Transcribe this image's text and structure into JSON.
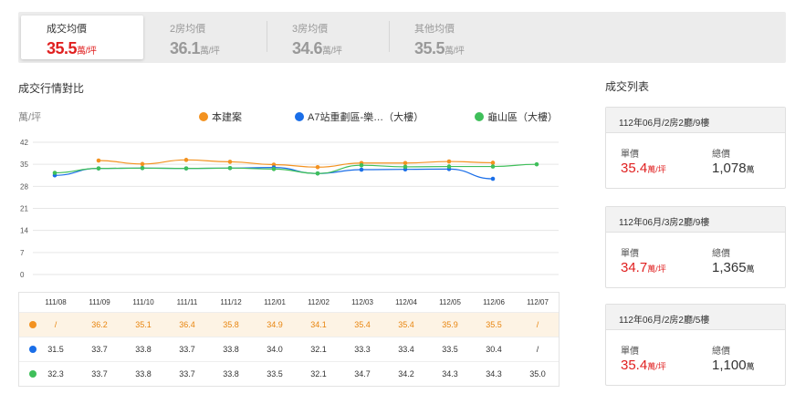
{
  "tabs": [
    {
      "label": "成交均價",
      "value": "35.5",
      "unit": "萬/坪"
    },
    {
      "label": "2房均價",
      "value": "36.1",
      "unit": "萬/坪"
    },
    {
      "label": "3房均價",
      "value": "34.6",
      "unit": "萬/坪"
    },
    {
      "label": "其他均價",
      "value": "35.5",
      "unit": "萬/坪"
    }
  ],
  "trend": {
    "title": "成交行情對比",
    "unit": "萬/坪",
    "legend": [
      "本建案",
      "A7站重劃區-樂…（大樓）",
      "龜山區（大樓）"
    ]
  },
  "chart_data": {
    "type": "line",
    "x": [
      "111/08",
      "111/09",
      "111/10",
      "111/11",
      "111/12",
      "112/01",
      "112/02",
      "112/03",
      "112/04",
      "112/05",
      "112/06",
      "112/07"
    ],
    "ylim": [
      0,
      42
    ],
    "yticks": [
      0,
      7,
      14,
      21,
      28,
      35,
      42
    ],
    "grid": true,
    "legend_position": "top",
    "series": [
      {
        "name": "本建案",
        "color": "#f39220",
        "values": [
          null,
          36.2,
          35.1,
          36.4,
          35.8,
          34.9,
          34.1,
          35.4,
          35.4,
          35.9,
          35.5,
          null
        ],
        "labels": [
          "/",
          "36.2",
          "35.1",
          "36.4",
          "35.8",
          "34.9",
          "34.1",
          "35.4",
          "35.4",
          "35.9",
          "35.5",
          "/"
        ]
      },
      {
        "name": "A7站重劃區-樂…（大樓）",
        "color": "#1a6ee8",
        "values": [
          31.5,
          33.7,
          33.8,
          33.7,
          33.8,
          34.0,
          32.1,
          33.3,
          33.4,
          33.5,
          30.4,
          null
        ],
        "labels": [
          "31.5",
          "33.7",
          "33.8",
          "33.7",
          "33.8",
          "34.0",
          "32.1",
          "33.3",
          "33.4",
          "33.5",
          "30.4",
          "/"
        ]
      },
      {
        "name": "龜山區（大樓）",
        "color": "#3fbf5a",
        "values": [
          32.3,
          33.7,
          33.8,
          33.7,
          33.8,
          33.5,
          32.1,
          34.7,
          34.2,
          34.3,
          34.3,
          35.0
        ],
        "labels": [
          "32.3",
          "33.7",
          "33.8",
          "33.7",
          "33.8",
          "33.5",
          "32.1",
          "34.7",
          "34.2",
          "34.3",
          "34.3",
          "35.0"
        ]
      }
    ]
  },
  "list": {
    "title": "成交列表",
    "unit_label": "單價",
    "total_label": "總價",
    "price_unit": "萬/坪",
    "total_unit": "萬",
    "items": [
      {
        "title": "112年06月/2房2廳/9樓",
        "unit_price": "35.4",
        "total": "1,078"
      },
      {
        "title": "112年06月/3房2廳/9樓",
        "unit_price": "34.7",
        "total": "1,365"
      },
      {
        "title": "112年06月/2房2廳/5樓",
        "unit_price": "35.4",
        "total": "1,100"
      }
    ]
  }
}
